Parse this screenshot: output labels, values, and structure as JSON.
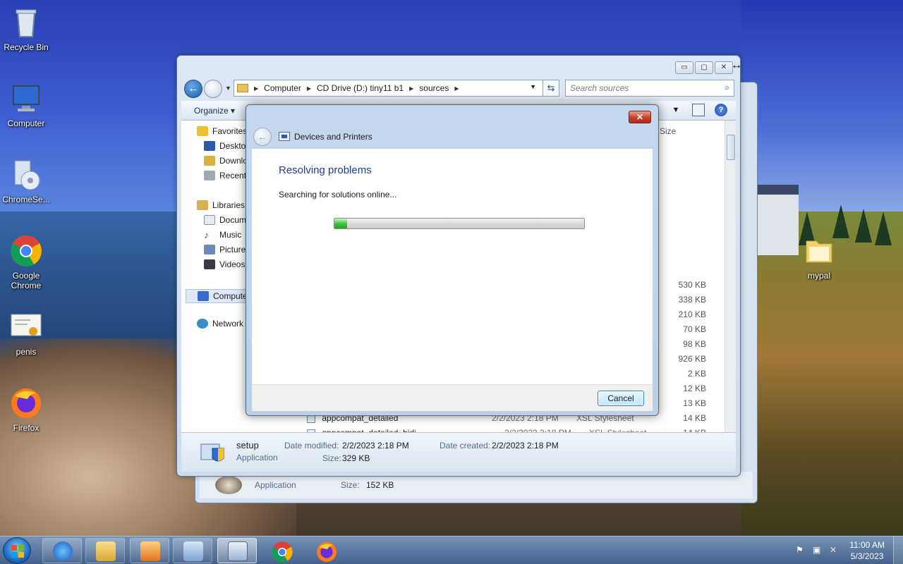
{
  "desktop": {
    "icons": [
      {
        "label": "Recycle Bin"
      },
      {
        "label": "Computer"
      },
      {
        "label": "ChromeSe..."
      },
      {
        "label": "Google Chrome"
      },
      {
        "label": "penis"
      },
      {
        "label": "Firefox"
      },
      {
        "label": "mypal"
      }
    ]
  },
  "explorer": {
    "caption_buttons": {
      "minimize": "▭",
      "maximize": "▢",
      "close": "✕"
    },
    "nav": {
      "back": "←"
    },
    "address": {
      "crumbs": [
        "Computer",
        "CD Drive (D:) tiny11 b1",
        "sources"
      ]
    },
    "search": {
      "placeholder": "Search sources"
    },
    "toolbar": {
      "organize": "Organize ▾"
    },
    "nav_pane": {
      "favorites": "Favorites",
      "desktop": "Desktop",
      "downloads": "Downlo",
      "recent": "Recent",
      "libraries": "Libraries",
      "documents": "Docum",
      "music": "Music",
      "pictures": "Pictures",
      "videos": "Videos",
      "computer": "Compute",
      "network": "Network"
    },
    "column_header": "Size",
    "sizes": [
      "530 KB",
      "338 KB",
      "210 KB",
      "70 KB",
      "98 KB",
      "926 KB",
      "2 KB",
      "12 KB",
      "13 KB",
      "14 KB",
      "14 KB"
    ],
    "partial_rows": [
      {
        "name": "appcompat_detailed",
        "date": "2/2/2023 2:18 PM",
        "type": "XSL Stylesheet"
      },
      {
        "name": "appcompat_detailed_bidi",
        "date": "2/2/2023 2:18 PM",
        "type": "XSL Stylesheet"
      }
    ],
    "details": {
      "name": "setup",
      "type": "Application",
      "date_modified_label": "Date modified:",
      "date_modified": "2/2/2023 2:18 PM",
      "date_created_label": "Date created:",
      "date_created": "2/2/2023 2:18 PM",
      "size_label": "Size:",
      "size": "329 KB"
    },
    "back_details": {
      "type": "Application",
      "size_label": "Size:",
      "size": "152 KB"
    }
  },
  "dialog": {
    "close": "✕",
    "back": "←",
    "title": "Devices and Printers",
    "heading": "Resolving problems",
    "message": "Searching for solutions online...",
    "progress": 0.05,
    "cancel": "Cancel"
  },
  "taskbar": {
    "clock_time": "11:00 AM",
    "clock_date": "5/3/2023"
  },
  "colors": {
    "accent": "#1e3f8a",
    "progress_green": "#37c13c"
  }
}
